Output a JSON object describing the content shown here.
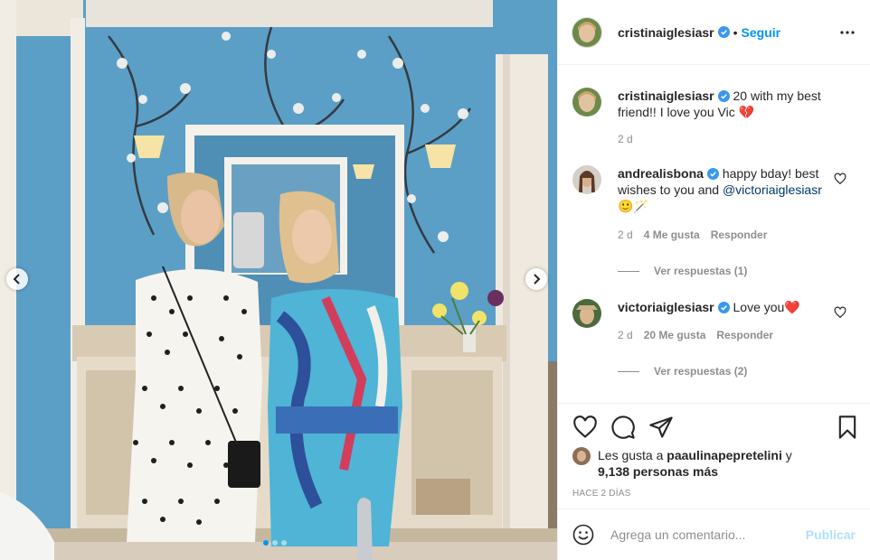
{
  "post": {
    "author": "cristinaiglesiasr",
    "separator": "•",
    "follow_label": "Seguir",
    "more_icon": "more-horizontal-icon",
    "carousel": {
      "slide_count": 3,
      "active_index": 0
    }
  },
  "caption": {
    "username": "cristinaiglesiasr",
    "text": "20 with my best friend!! I love you Vic 💔",
    "time": "2 d"
  },
  "comments": [
    {
      "username": "andrealisbona",
      "text_before": "happy bday! best wishes to you and ",
      "mention": "@victoriaiglesiasr",
      "text_after": " 🙂🪄",
      "time": "2 d",
      "likes": "4 Me gusta",
      "reply_label": "Responder",
      "view_replies": "Ver respuestas (1)"
    },
    {
      "username": "victoriaiglesiasr",
      "text": "Love you❤️",
      "time": "2 d",
      "likes": "20 Me gusta",
      "reply_label": "Responder",
      "view_replies": "Ver respuestas (2)"
    }
  ],
  "likes_summary": {
    "prefix": "Les gusta a ",
    "user": "paaulinapepretelini",
    "connector": " y",
    "others": "9,138 personas más"
  },
  "time_ago": "HACE 2 DÍAS",
  "composer": {
    "placeholder": "Agrega un comentario...",
    "publish_label": "Publicar"
  },
  "colors": {
    "accent": "#0095f6",
    "verified": "#3897f0",
    "publish_disabled": "#b2dffc",
    "wallpaper": "#5b9fc7"
  }
}
